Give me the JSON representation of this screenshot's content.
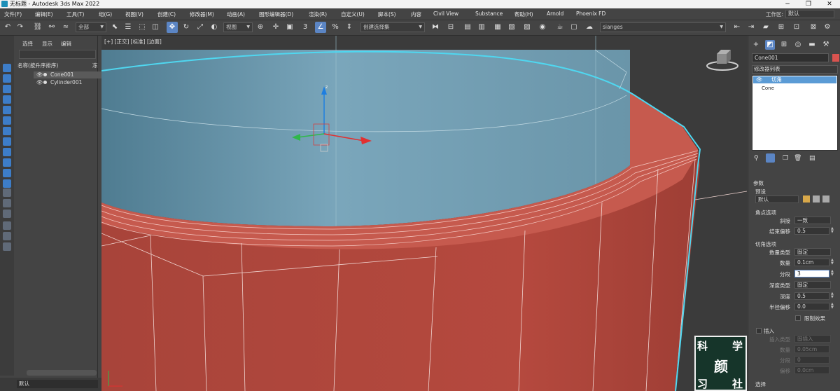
{
  "window": {
    "title": "无标题 - Autodesk 3ds Max 2022"
  },
  "menu": [
    "文件(F)",
    "编辑(E)",
    "工具(T)",
    "组(G)",
    "视图(V)",
    "创建(C)",
    "修改器(M)",
    "动画(A)",
    "图形编辑器(D)",
    "渲染(R)",
    "自定义(U)",
    "脚本(S)",
    "内容",
    "Civil View",
    "Substance",
    "帮助(H)",
    "Arnold",
    "Phoenix FD"
  ],
  "workspace": {
    "label": "工作区:",
    "value": "默认"
  },
  "toolbar": {
    "filter": "全部",
    "refcoord": "视图",
    "selset": "创建选择集",
    "namedset": "sianges"
  },
  "scene_explorer": {
    "tabs": [
      "选择",
      "显示",
      "编辑"
    ],
    "column_header": "名称(按升序排序)",
    "column_extra": "冻",
    "items": [
      {
        "name": "Cone001",
        "selected": true
      },
      {
        "name": "Cylinder001",
        "selected": false
      }
    ]
  },
  "status": {
    "layer": "默认"
  },
  "viewport": {
    "label": "[+] [正交] [标准] [边面]",
    "axis_label": "z"
  },
  "command_panel": {
    "object_name": "Cone001",
    "object_color": "#d9534f",
    "modifier_list": "修改器列表",
    "stack": [
      "切角",
      "Cone"
    ],
    "rollout_title": "参数",
    "preset_label": "预设",
    "preset_value": "默认",
    "corner_section": "角点选项",
    "corner": [
      {
        "label": "斜接",
        "value": "一致"
      },
      {
        "label": "结束偏移",
        "value": "0.5"
      }
    ],
    "chamfer_section": "切角选项",
    "chamfer": [
      {
        "label": "数量类型",
        "value": "固定"
      },
      {
        "label": "数量",
        "value": "0.1cm"
      },
      {
        "label": "分段",
        "value": "3"
      },
      {
        "label": "深度类型",
        "value": "固定"
      },
      {
        "label": "深度",
        "value": "0.5"
      },
      {
        "label": "半径偏移",
        "value": "0.0"
      }
    ],
    "limit_effect": "限制效果",
    "insert_section": "插入",
    "insert": [
      {
        "label": "插入类型",
        "value": "固插入"
      },
      {
        "label": "数量",
        "value": "0.05cm"
      },
      {
        "label": "分段",
        "value": "0"
      },
      {
        "label": "偏移",
        "value": "0.0cm"
      }
    ],
    "select_section": "选择"
  },
  "watermark": {
    "chars": [
      "科",
      "学",
      "颜",
      "习",
      "社"
    ]
  },
  "colors": {
    "cylinder": "#6f9cb0",
    "cone": "#b34a3e",
    "highlight": "#4fd7f0",
    "accent": "#5b85c4"
  }
}
